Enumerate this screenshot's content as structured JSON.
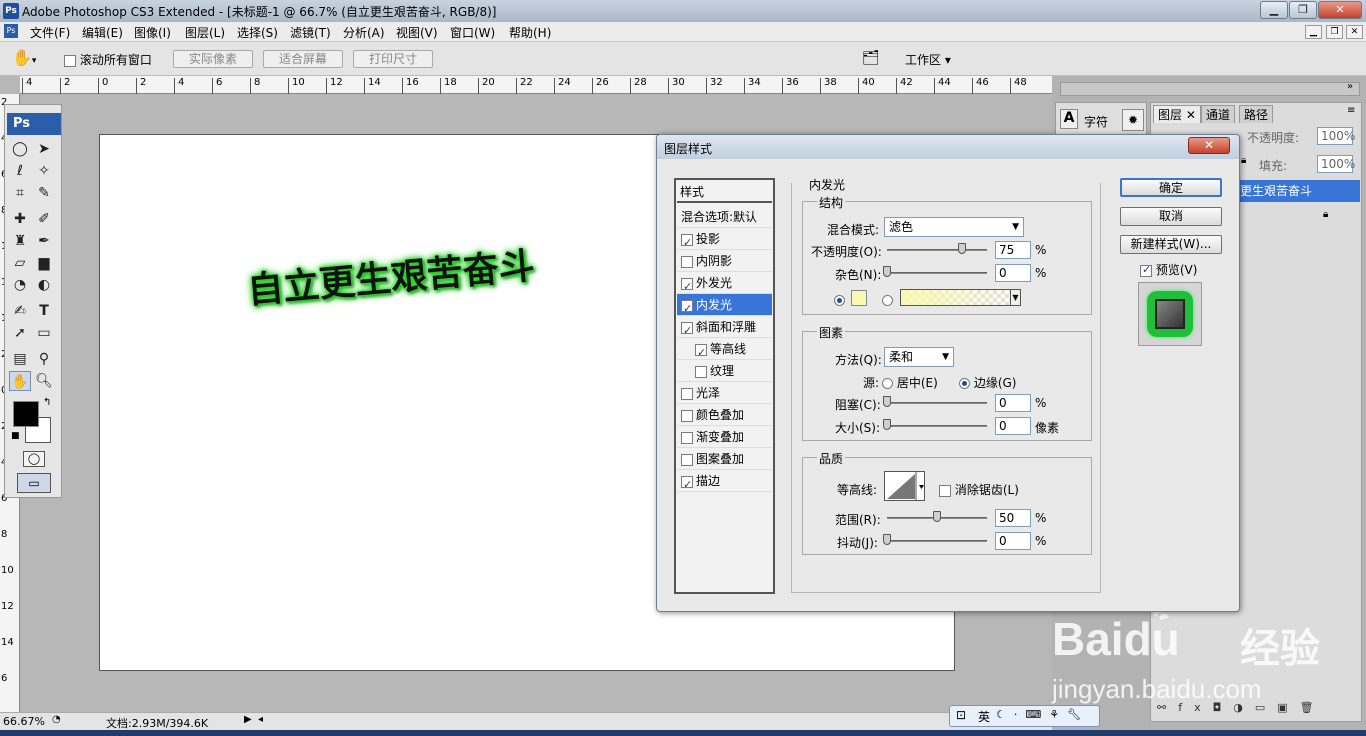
{
  "titlebar": {
    "title": "Adobe Photoshop CS3 Extended - [未标题-1 @ 66.7% (自立更生艰苦奋斗, RGB/8)]",
    "logo": "Ps"
  },
  "menu": [
    "文件(F)",
    "编辑(E)",
    "图像(I)",
    "图层(L)",
    "选择(S)",
    "滤镜(T)",
    "分析(A)",
    "视图(V)",
    "窗口(W)",
    "帮助(H)"
  ],
  "options": {
    "scroll_all": "滚动所有窗口",
    "actual_pixels": "实际像素",
    "fit_screen": "适合屏幕",
    "print_size": "打印尺寸",
    "workspace": "工作区 ▾"
  },
  "ruler_top": [
    "4",
    "2",
    "0",
    "2",
    "4",
    "6",
    "8",
    "10",
    "12",
    "14",
    "16",
    "18",
    "20",
    "22",
    "24",
    "26",
    "28",
    "30",
    "32",
    "34",
    "36",
    "38",
    "40",
    "42",
    "44",
    "46",
    "48"
  ],
  "ruler_left": [
    "2",
    "4",
    "6",
    "8",
    "10",
    "12",
    "14",
    "2",
    "0",
    "2",
    "4",
    "6",
    "8",
    "10",
    "12",
    "14",
    "6"
  ],
  "canvas_text": "自立更生艰苦奋斗",
  "status": {
    "zoom": "66.67%",
    "doc": "文档:2.93M/394.6K"
  },
  "panels": {
    "char_tab": "字符",
    "tabs": [
      "图层",
      "通道",
      "路径"
    ],
    "opacity_label": "不透明度:",
    "opacity": "100%",
    "fill_label": "填充:",
    "fill": "100%",
    "layer_name": "更生艰苦奋斗"
  },
  "ime": {
    "lang": "英"
  },
  "watermark": {
    "brand": "Baidu",
    "suffix": "经验",
    "url": "jingyan.baidu.com"
  },
  "dialog": {
    "title": "图层样式",
    "styles_header": "样式",
    "styles": [
      {
        "label": "混合选项:默认",
        "check": null,
        "selected": false,
        "sub": false
      },
      {
        "label": "投影",
        "check": true,
        "selected": false,
        "sub": false
      },
      {
        "label": "内阴影",
        "check": false,
        "selected": false,
        "sub": false
      },
      {
        "label": "外发光",
        "check": true,
        "selected": false,
        "sub": false
      },
      {
        "label": "内发光",
        "check": true,
        "selected": true,
        "sub": false
      },
      {
        "label": "斜面和浮雕",
        "check": true,
        "selected": false,
        "sub": false
      },
      {
        "label": "等高线",
        "check": true,
        "selected": false,
        "sub": true
      },
      {
        "label": "纹理",
        "check": false,
        "selected": false,
        "sub": true
      },
      {
        "label": "光泽",
        "check": false,
        "selected": false,
        "sub": false
      },
      {
        "label": "颜色叠加",
        "check": false,
        "selected": false,
        "sub": false
      },
      {
        "label": "渐变叠加",
        "check": false,
        "selected": false,
        "sub": false
      },
      {
        "label": "图案叠加",
        "check": false,
        "selected": false,
        "sub": false
      },
      {
        "label": "描边",
        "check": true,
        "selected": false,
        "sub": false
      }
    ],
    "section": "内发光",
    "structure": {
      "title": "结构",
      "blend_label": "混合模式:",
      "blend": "滤色",
      "opacity_label": "不透明度(O):",
      "opacity": "75",
      "noise_label": "杂色(N):",
      "noise": "0",
      "pct": "%",
      "glow_color": "#fbf7b4"
    },
    "elements": {
      "title": "图素",
      "method_label": "方法(Q):",
      "method": "柔和",
      "source_label": "源:",
      "center": "居中(E)",
      "edge": "边缘(G)",
      "choke_label": "阻塞(C):",
      "choke": "0",
      "size_label": "大小(S):",
      "size": "0",
      "px": "像素"
    },
    "quality": {
      "title": "品质",
      "contour_label": "等高线:",
      "antialias": "消除锯齿(L)",
      "range_label": "范围(R):",
      "range": "50",
      "jitter_label": "抖动(J):",
      "jitter": "0"
    },
    "ok": "确定",
    "cancel": "取消",
    "new_style": "新建样式(W)...",
    "preview": "预览(V)"
  },
  "values": {
    "opacity": 0.75,
    "noise": 0,
    "choke": 0,
    "size": 0,
    "range": 0.5,
    "jitter": 0
  }
}
